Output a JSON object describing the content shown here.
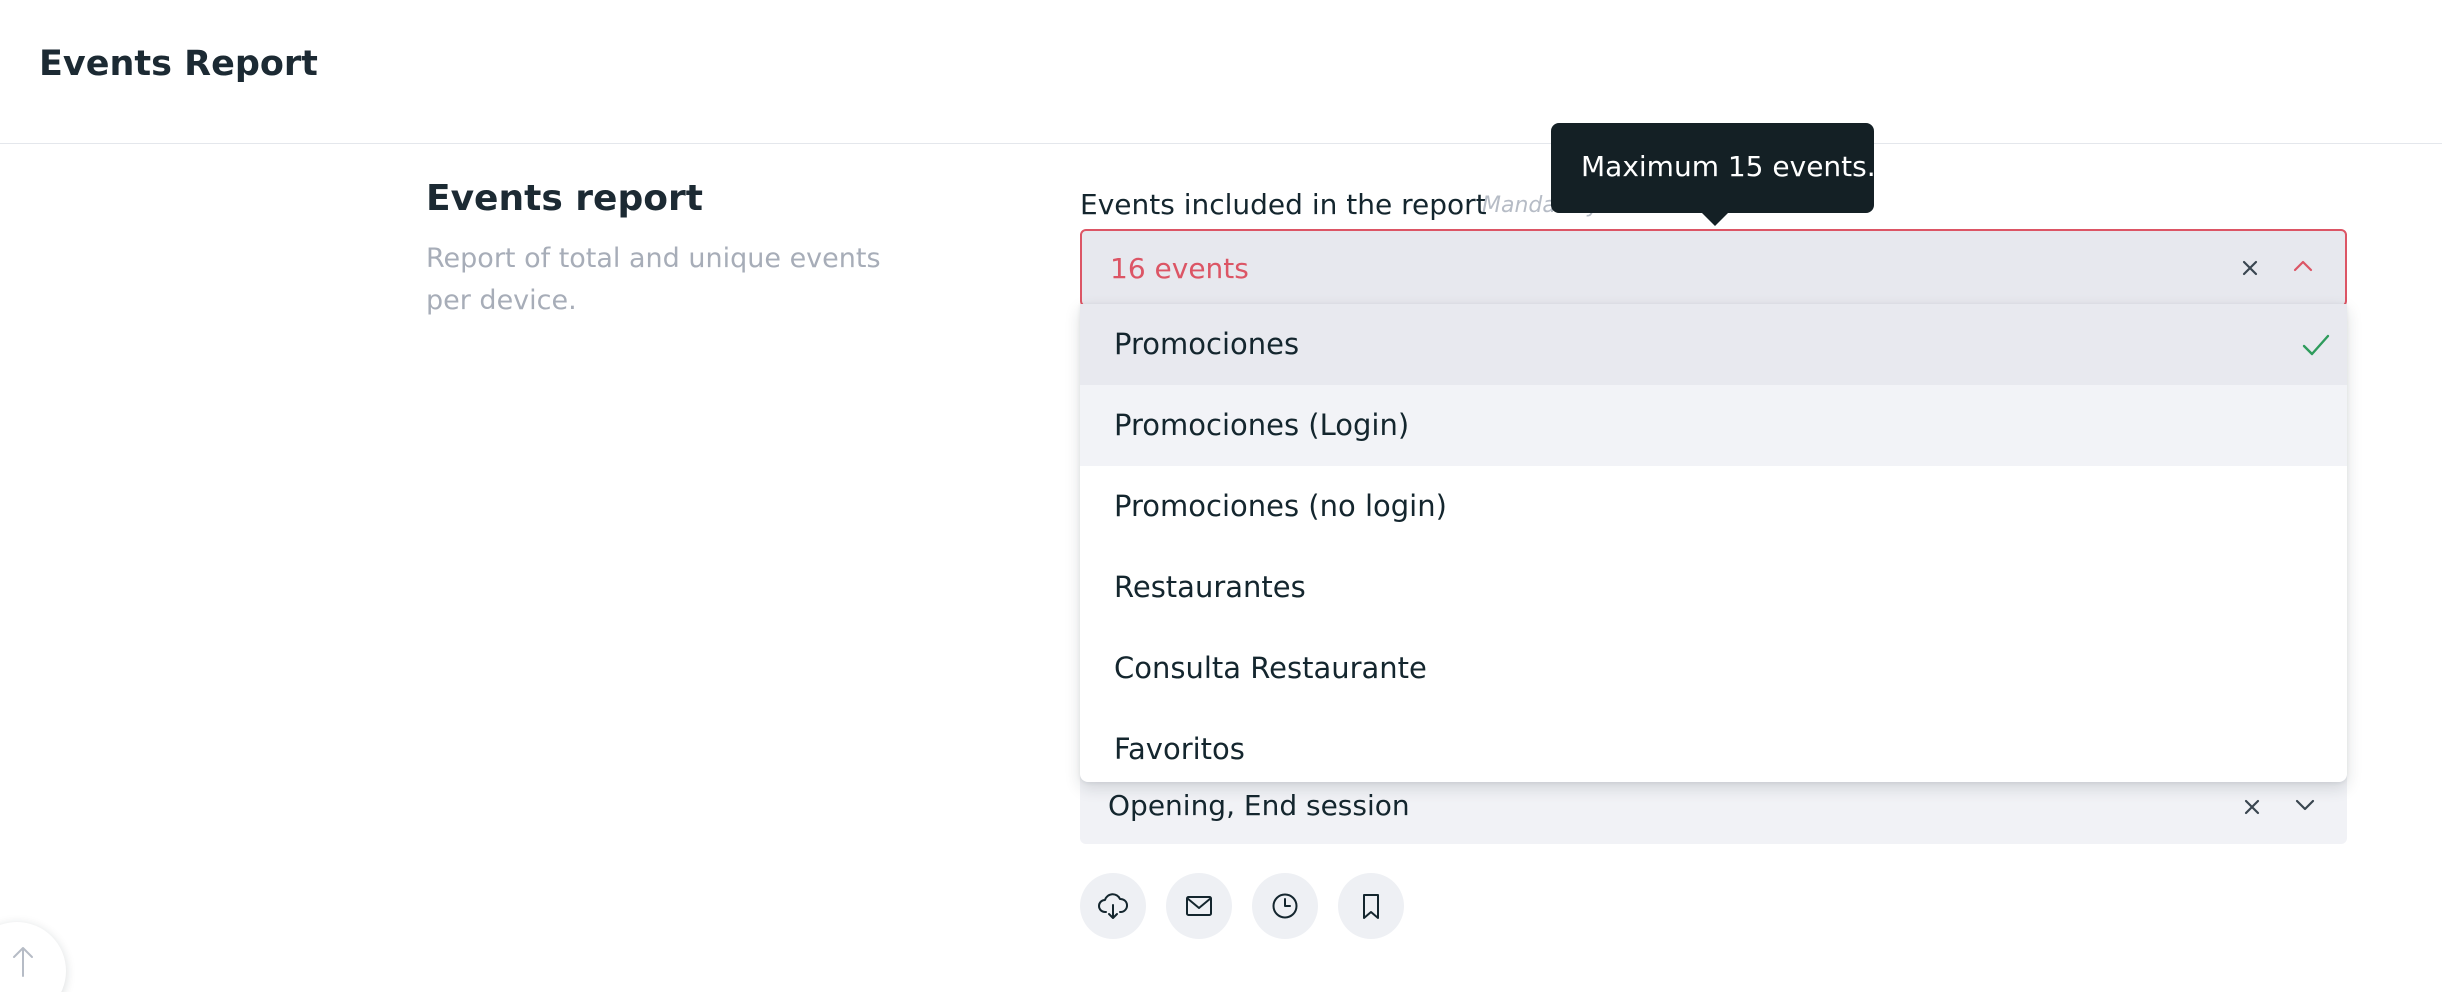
{
  "header": {
    "title": "Events Report"
  },
  "section": {
    "title": "Events report",
    "description": "Report of total and unique events per device."
  },
  "events_field": {
    "label": "Events included in the report",
    "hint": "Mandatory",
    "value": "16 events",
    "tooltip": "Maximum 15 events.",
    "options": [
      {
        "label": "Promociones",
        "selected": true
      },
      {
        "label": "Promociones (Login)",
        "selected": false
      },
      {
        "label": "Promociones (no login)",
        "selected": false
      },
      {
        "label": "Restaurantes",
        "selected": false
      },
      {
        "label": "Consulta Restaurante",
        "selected": false
      },
      {
        "label": "Favoritos",
        "selected": false
      }
    ]
  },
  "second_field": {
    "value": "Opening, End session"
  },
  "actions": [
    {
      "icon": "cloud-download-icon"
    },
    {
      "icon": "mail-icon"
    },
    {
      "icon": "clock-icon"
    },
    {
      "icon": "bookmark-icon"
    }
  ],
  "colors": {
    "error": "#dc5565",
    "tooltip_bg": "#142025",
    "check": "#2e9b5c",
    "text": "#14262e",
    "muted": "#a7adb8"
  }
}
